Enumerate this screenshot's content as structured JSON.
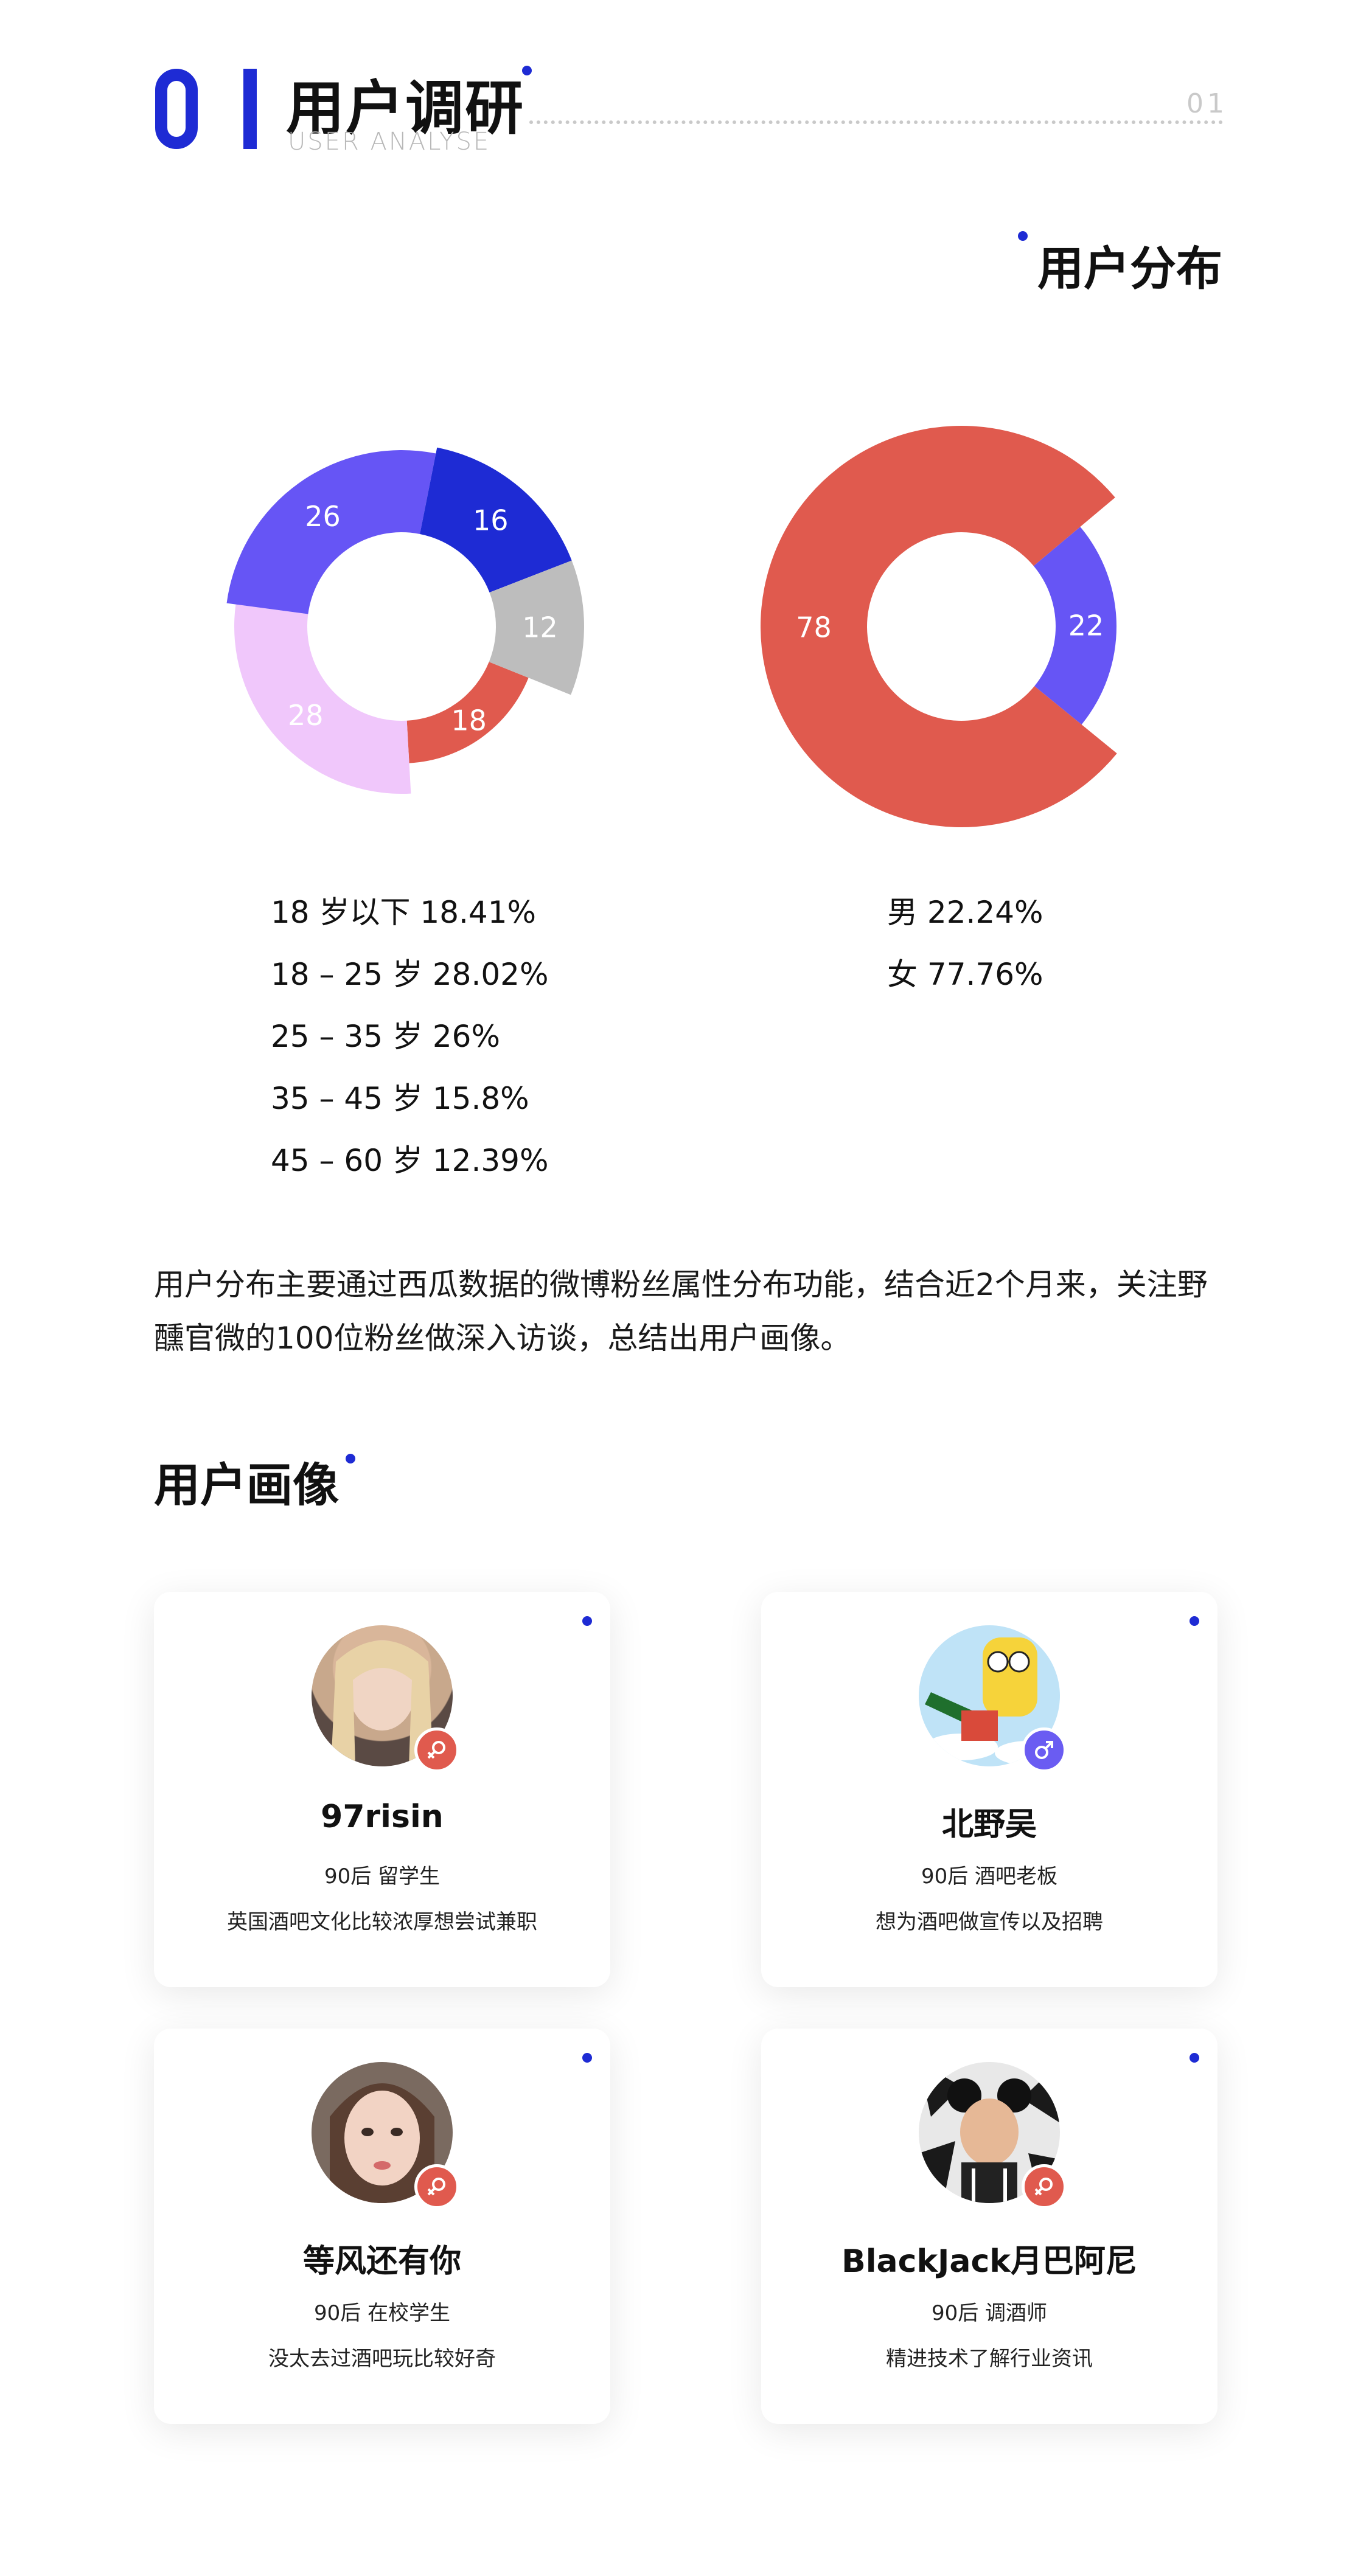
{
  "header": {
    "number_zero": "0",
    "number_one": "1",
    "title": "用户调研",
    "subtitle": "USER ANALYSE",
    "page_no": "01"
  },
  "distribution": {
    "title": "用户分布",
    "age_legend": [
      "18 岁以下 18.41%",
      "18 – 25 岁 28.02%",
      "25 – 35 岁 26%",
      "35 – 45 岁 15.8%",
      "45 – 60 岁 12.39%"
    ],
    "gender_legend": [
      "男 22.24%",
      "女 77.76%"
    ],
    "paragraph": "用户分布主要通过西瓜数据的微博粉丝属性分布功能，结合近2个月来，关注野醺官微的100位粉丝做深入访谈，总结出用户画像。"
  },
  "chart_data": [
    {
      "type": "pie",
      "title": "",
      "categories": [
        "18 岁以下",
        "18 – 25 岁",
        "25 – 35 岁",
        "35 – 45 岁",
        "45 – 60 岁"
      ],
      "values": [
        18,
        28,
        26,
        16,
        12
      ],
      "percent_labels": [
        "18.41%",
        "28.02%",
        "26%",
        "15.8%",
        "12.39%"
      ],
      "colors": [
        "#e05a4e",
        "#f0c7fb",
        "#6655f5",
        "#1e2bd4",
        "#bdbdbd"
      ],
      "donut": true
    },
    {
      "type": "pie",
      "title": "",
      "categories": [
        "男",
        "女"
      ],
      "values": [
        22,
        78
      ],
      "percent_labels": [
        "22.24%",
        "77.76%"
      ],
      "colors": [
        "#6655f5",
        "#e05a4e"
      ],
      "donut": true
    }
  ],
  "portraits": {
    "title": "用户画像",
    "cards": [
      {
        "name": "97risin",
        "meta": "90后   留学生",
        "desc": "英国酒吧文化比较浓厚想尝试兼职",
        "gender": "female",
        "avatar_icon": "avatar-photo-icon"
      },
      {
        "name": "北野吴",
        "meta": "90后  酒吧老板",
        "desc": "想为酒吧做宣传以及招聘",
        "gender": "male",
        "avatar_icon": "avatar-cartoon-icon"
      },
      {
        "name": "等风还有你",
        "meta": "90后   在校学生",
        "desc": "没太去过酒吧玩比较好奇",
        "gender": "female",
        "avatar_icon": "avatar-photo-icon"
      },
      {
        "name": "BlackJack月巴阿尼",
        "meta": "90后   调酒师",
        "desc": "精进技术了解行业资讯",
        "gender": "female",
        "avatar_icon": "avatar-comic-icon"
      }
    ]
  },
  "colors": {
    "accent": "#1e2bd4",
    "female": "#e05a4e",
    "male": "#6a5cf2"
  }
}
